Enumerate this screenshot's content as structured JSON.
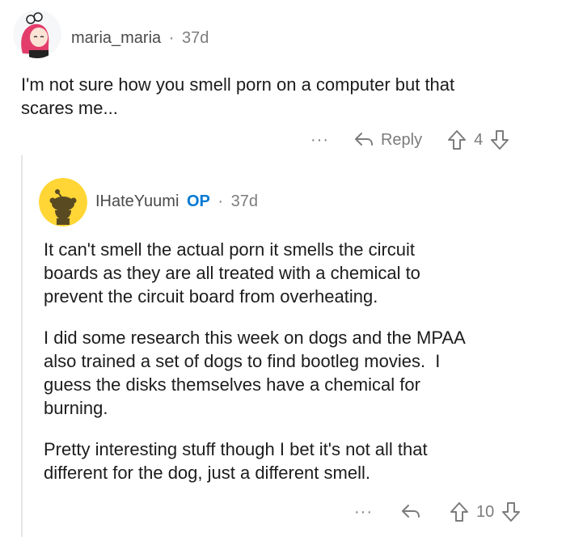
{
  "comment1": {
    "username": "maria_maria",
    "separator": "·",
    "time": "37d",
    "text_lines": [
      "I'm not sure how you smell porn on a computer but that",
      "scares me..."
    ],
    "actions": {
      "more": "···",
      "reply": "Reply",
      "votes": "4"
    }
  },
  "comment2": {
    "username": "IHateYuumi",
    "op_badge": "OP",
    "separator": "·",
    "time": "37d",
    "paragraphs": [
      [
        "It can't smell the actual porn it smells the circuit",
        "boards as they are all treated with a chemical to",
        "prevent the circuit board from overheating."
      ],
      [
        "I did some research this week on dogs and the MPAA",
        "also trained a set of dogs to find bootleg movies.  I",
        "guess the disks themselves have a chemical for",
        "burning."
      ],
      [
        "Pretty interesting stuff though I bet it's not all that",
        "different for the dog, just a different smell."
      ]
    ],
    "actions": {
      "more": "···",
      "votes": "10"
    }
  },
  "colors": {
    "text": "#1c1c1c",
    "meta": "#7c7c7c",
    "op": "#0079d3",
    "avatar_yellow": "#ffd635",
    "avatar_pink": "#e33d6b"
  }
}
